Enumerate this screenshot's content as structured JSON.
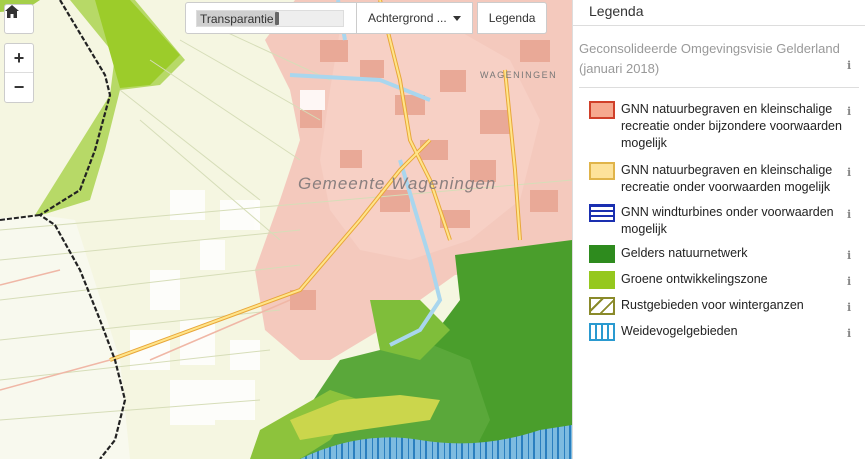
{
  "toolbar": {
    "transparency_label": "Transparantie",
    "transparency_value": 0.55,
    "background_label": "Achtergrond ...",
    "legend_label": "Legenda"
  },
  "map": {
    "municipality_label": "Gemeente  Wageningen",
    "town_label": "WAGENINGEN",
    "home_icon": "home-icon",
    "zoom_in": "+",
    "zoom_out": "−"
  },
  "panel": {
    "title": "Legenda",
    "layer_title": "Geconsolideerde Omgevingsvisie Gelderland (januari 2018)",
    "info_glyph": "i",
    "items": [
      {
        "label": "GNN natuurbegraven en kleinschalige recreatie onder bijzondere voorwaarden mogelijk",
        "fill": "#f6a98f",
        "border": "#d0402a",
        "pattern": "solid"
      },
      {
        "label": "GNN natuurbegraven en kleinschalige recreatie onder voorwaarden mogelijk",
        "fill": "#fde29a",
        "border": "#e0b44a",
        "pattern": "solid"
      },
      {
        "label": "GNN windturbines onder voorwaarden mogelijk",
        "fill": "#ffffff",
        "border": "#1a2fb0",
        "pattern": "horizontal-lines"
      },
      {
        "label": "Gelders natuurnetwerk",
        "fill": "#2e8b1e",
        "border": "#2e8b1e",
        "pattern": "solid"
      },
      {
        "label": "Groene ontwikkelingszone",
        "fill": "#95c81e",
        "border": "#95c81e",
        "pattern": "solid"
      },
      {
        "label": "Rustgebieden voor winterganzen",
        "fill": "#ffffff",
        "border": "#8a8a2a",
        "pattern": "diagonal-lines"
      },
      {
        "label": "Weidevogelgebieden",
        "fill": "#ffffff",
        "border": "#2a9ad0",
        "pattern": "vertical-lines"
      }
    ]
  }
}
